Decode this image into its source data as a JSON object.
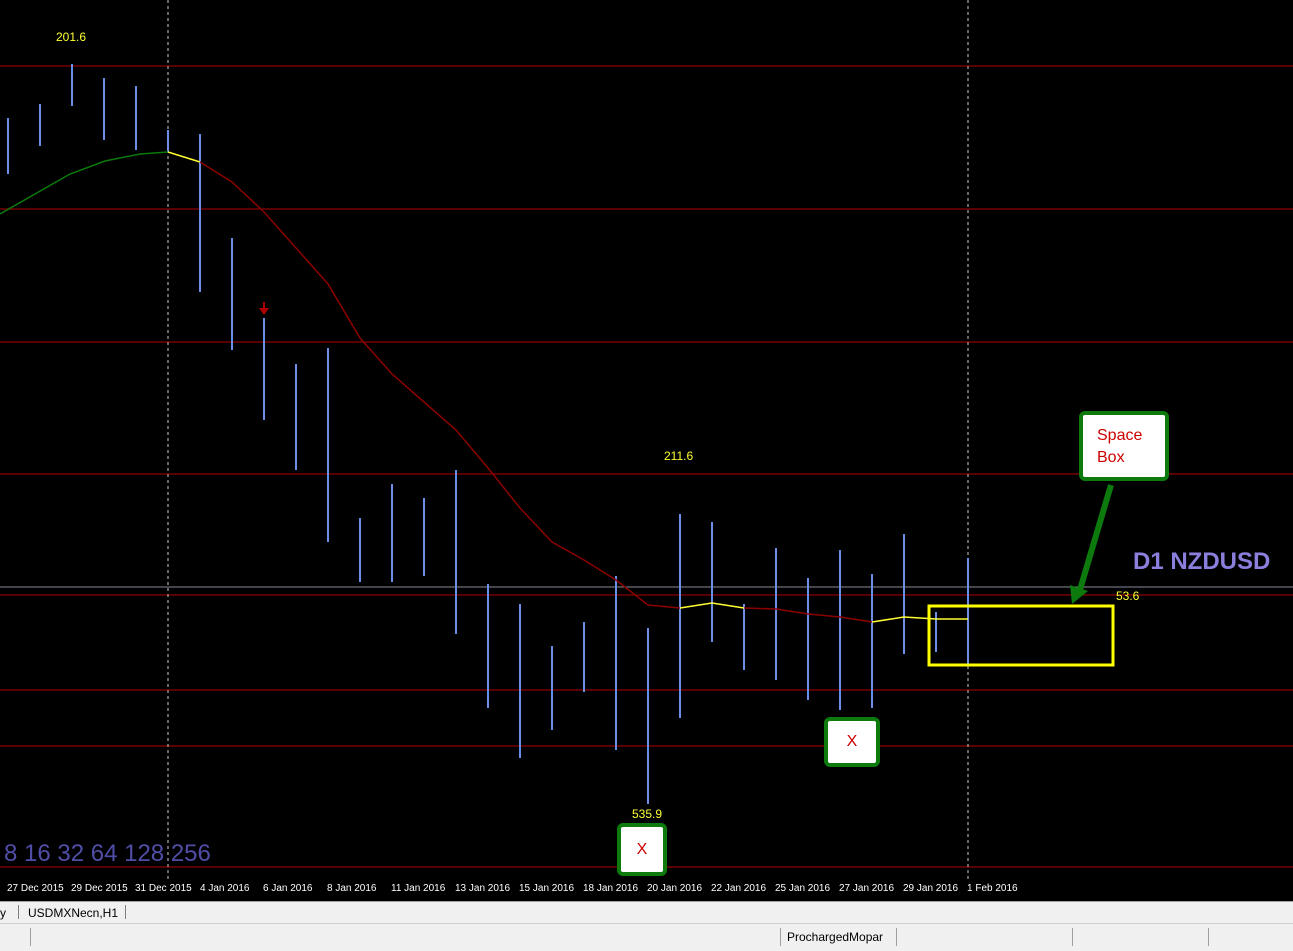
{
  "symbol_label": "D1 NZDUSD",
  "fib_text": "8 16 32 64 128 256",
  "price_labels": {
    "top": "201.6",
    "mid": "211.6",
    "box": "53.6",
    "bottom": "535.9"
  },
  "callouts": {
    "space_box": "Space\nBox",
    "x_mark": "X"
  },
  "time_labels": [
    "27 Dec 2015",
    "29 Dec 2015",
    "31 Dec 2015",
    "4 Jan 2016",
    "6 Jan 2016",
    "8 Jan 2016",
    "11 Jan 2016",
    "13 Jan 2016",
    "15 Jan 2016",
    "18 Jan 2016",
    "20 Jan 2016",
    "22 Jan 2016",
    "25 Jan 2016",
    "27 Jan 2016",
    "29 Jan 2016",
    "1 Feb 2016"
  ],
  "tabs": {
    "partial": "y",
    "active": "USDMXNecn,H1"
  },
  "status": {
    "user": "ProchargedMopar"
  },
  "colors": {
    "background": "#000000",
    "bar": "#6b8fe6",
    "grid_red": "#b00000",
    "ma_green": "#0a7a0a",
    "ma_red": "#8b0000",
    "ma_yellow": "#ffff33",
    "box": "#ffff00",
    "arrow": "#0d7a0d",
    "symbol": "#8a7fdc"
  },
  "icons": {
    "sell_arrow": "down-arrow-icon"
  }
}
